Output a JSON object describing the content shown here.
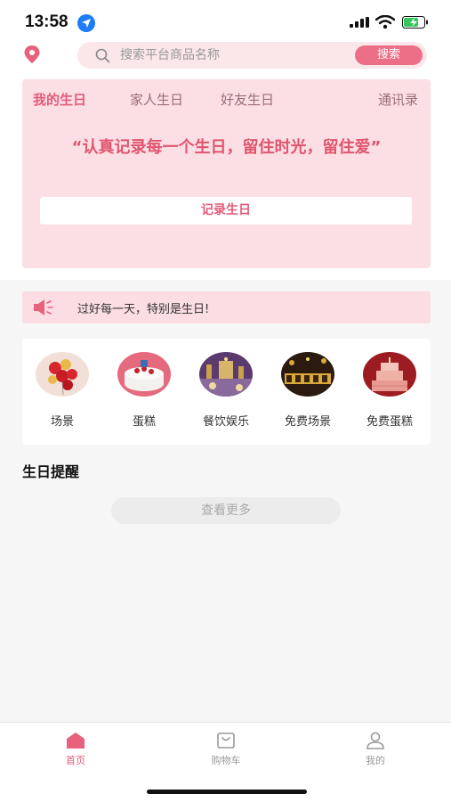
{
  "status_bar": {
    "time": "13:58"
  },
  "search": {
    "placeholder": "搜索平台商品名称",
    "button_label": "搜索"
  },
  "birthday_card": {
    "tabs": [
      {
        "label": "我的生日",
        "active": true
      },
      {
        "label": "家人生日",
        "active": false
      },
      {
        "label": "好友生日",
        "active": false
      }
    ],
    "contacts_label": "通讯录",
    "slogan": "“认真记录每一个生日，留住时光，留住爱”",
    "record_button_label": "记录生日"
  },
  "notice": {
    "text": "过好每一天，特别是生日!"
  },
  "categories": [
    {
      "label": "场景",
      "icon": "balloons-image"
    },
    {
      "label": "蛋糕",
      "icon": "cake-image"
    },
    {
      "label": "餐饮娱乐",
      "icon": "dining-image"
    },
    {
      "label": "免费场景",
      "icon": "birthday-banner-image"
    },
    {
      "label": "免费蛋糕",
      "icon": "tiered-cake-image"
    }
  ],
  "reminder": {
    "title": "生日提醒",
    "more_button_label": "查看更多"
  },
  "bottom_nav": [
    {
      "label": "首页",
      "icon": "home-icon",
      "active": true
    },
    {
      "label": "购物车",
      "icon": "cart-icon",
      "active": false
    },
    {
      "label": "我的",
      "icon": "user-icon",
      "active": false
    }
  ],
  "colors": {
    "accent": "#e45a78",
    "card_background": "#fcdfe5",
    "search_button": "#ec6e87"
  }
}
